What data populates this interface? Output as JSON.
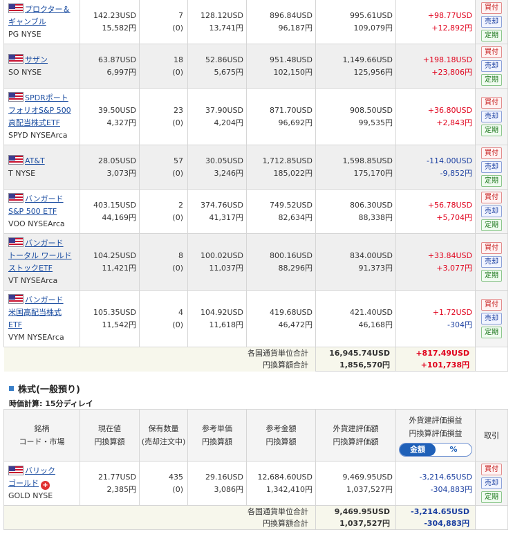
{
  "holdings": [
    {
      "name_lines": [
        "プロクター＆",
        "ギャンブル"
      ],
      "market": "PG NYSE",
      "price_usd": "142.23USD",
      "price_jpy": "15,582円",
      "qty": "7",
      "qty_order": "(0)",
      "cost_usd": "128.12USD",
      "cost_jpy": "13,741円",
      "book_usd": "896.84USD",
      "book_jpy": "96,187円",
      "value_usd": "995.61USD",
      "value_jpy": "109,079円",
      "pl_usd": "+98.77USD",
      "pl_jpy": "+12,892円",
      "pl_usd_sign": "pos",
      "pl_jpy_sign": "pos",
      "row_h": 64
    },
    {
      "name_lines": [
        "サザン"
      ],
      "market": "SO NYSE",
      "price_usd": "63.87USD",
      "price_jpy": "6,997円",
      "qty": "18",
      "qty_order": "(0)",
      "cost_usd": "52.86USD",
      "cost_jpy": "5,675円",
      "book_usd": "951.48USD",
      "book_jpy": "102,150円",
      "value_usd": "1,149.66USD",
      "value_jpy": "125,956円",
      "pl_usd": "+198.18USD",
      "pl_jpy": "+23,806円",
      "pl_usd_sign": "pos",
      "pl_jpy_sign": "pos",
      "row_h": 63
    },
    {
      "name_lines": [
        "SPDRポート",
        "フォリオS&P 500",
        "高配当株式ETF"
      ],
      "market": "SPYD NYSEArca",
      "price_usd": "39.50USD",
      "price_jpy": "4,327円",
      "qty": "23",
      "qty_order": "(0)",
      "cost_usd": "37.90USD",
      "cost_jpy": "4,204円",
      "book_usd": "871.70USD",
      "book_jpy": "96,692円",
      "value_usd": "908.50USD",
      "value_jpy": "99,535円",
      "pl_usd": "+36.80USD",
      "pl_jpy": "+2,843円",
      "pl_usd_sign": "pos",
      "pl_jpy_sign": "pos",
      "row_h": 82
    },
    {
      "name_lines": [
        "AT&T"
      ],
      "market": "T NYSE",
      "price_usd": "28.05USD",
      "price_jpy": "3,073円",
      "qty": "57",
      "qty_order": "(0)",
      "cost_usd": "30.05USD",
      "cost_jpy": "3,246円",
      "book_usd": "1,712.85USD",
      "book_jpy": "185,022円",
      "value_usd": "1,598.85USD",
      "value_jpy": "175,170円",
      "pl_usd": "-114.00USD",
      "pl_jpy": "-9,852円",
      "pl_usd_sign": "neg",
      "pl_jpy_sign": "neg",
      "row_h": 63
    },
    {
      "name_lines": [
        "バンガード",
        "S&P 500 ETF"
      ],
      "market": "VOO NYSEArca",
      "price_usd": "403.15USD",
      "price_jpy": "44,169円",
      "qty": "2",
      "qty_order": "(0)",
      "cost_usd": "374.76USD",
      "cost_jpy": "41,317円",
      "book_usd": "749.52USD",
      "book_jpy": "82,634円",
      "value_usd": "806.30USD",
      "value_jpy": "88,338円",
      "pl_usd": "+56.78USD",
      "pl_jpy": "+5,704円",
      "pl_usd_sign": "pos",
      "pl_jpy_sign": "pos",
      "row_h": 63
    },
    {
      "name_lines": [
        "バンガード",
        "トータル ワールド",
        "ストックETF"
      ],
      "market": "VT NYSEArca",
      "price_usd": "104.25USD",
      "price_jpy": "11,421円",
      "qty": "8",
      "qty_order": "(0)",
      "cost_usd": "100.02USD",
      "cost_jpy": "11,037円",
      "book_usd": "800.16USD",
      "book_jpy": "88,296円",
      "value_usd": "834.00USD",
      "value_jpy": "91,373円",
      "pl_usd": "+33.84USD",
      "pl_jpy": "+3,077円",
      "pl_usd_sign": "pos",
      "pl_jpy_sign": "pos",
      "row_h": 82
    },
    {
      "name_lines": [
        "バンガード",
        "米国高配当株式",
        "ETF"
      ],
      "market": "VYM NYSEArca",
      "price_usd": "105.35USD",
      "price_jpy": "11,542円",
      "qty": "4",
      "qty_order": "(0)",
      "cost_usd": "104.92USD",
      "cost_jpy": "11,618円",
      "book_usd": "419.68USD",
      "book_jpy": "46,472円",
      "value_usd": "421.40USD",
      "value_jpy": "46,168円",
      "pl_usd": "+1.72USD",
      "pl_jpy": "-304円",
      "pl_usd_sign": "pos",
      "pl_jpy_sign": "neg",
      "row_h": 82
    }
  ],
  "actions": {
    "buy": "買付",
    "sell": "売却",
    "fixed": "定期"
  },
  "totals1": {
    "label_usd": "各国通貨単位合計",
    "label_jpy": "円換算額合計",
    "value_usd": "16,945.74USD",
    "value_jpy": "1,856,570円",
    "pl_usd": "+817.49USD",
    "pl_jpy": "+101,738円"
  },
  "section2": {
    "title": "株式(一般預り)",
    "subtitle": "時価計算: 15分ディレイ",
    "headers": {
      "h1": [
        "銘柄",
        "コード・市場"
      ],
      "h2": [
        "現在値",
        "円換算額"
      ],
      "h3": [
        "保有数量",
        "(売却注文中)"
      ],
      "h4": [
        "参考単価",
        "円換算額"
      ],
      "h5": [
        "参考金額",
        "円換算額"
      ],
      "h6": [
        "外貨建評価額",
        "円換算評価額"
      ],
      "h7": [
        "外貨建評価損益",
        "円換算評価損益"
      ],
      "h8": "取引"
    },
    "toggle": {
      "amount": "金額",
      "percent": "%"
    },
    "holding": {
      "name_lines": [
        "バリック",
        "ゴールド"
      ],
      "market": "GOLD NYSE",
      "price_usd": "21.77USD",
      "price_jpy": "2,385円",
      "qty": "435",
      "qty_order": "(0)",
      "cost_usd": "29.16USD",
      "cost_jpy": "3,086円",
      "book_usd": "12,684.60USD",
      "book_jpy": "1,342,410円",
      "value_usd": "9,469.95USD",
      "value_jpy": "1,037,527円",
      "pl_usd": "-3,214.65USD",
      "pl_jpy": "-304,883円"
    },
    "totals": {
      "label_usd": "各国通貨単位合計",
      "label_jpy": "円換算額合計",
      "value_usd": "9,469.95USD",
      "value_jpy": "1,037,527円",
      "pl_usd": "-3,214.65USD",
      "pl_jpy": "-304,883円"
    }
  },
  "colors": {
    "positive": "#e0001b",
    "negative": "#1b3fa0"
  }
}
